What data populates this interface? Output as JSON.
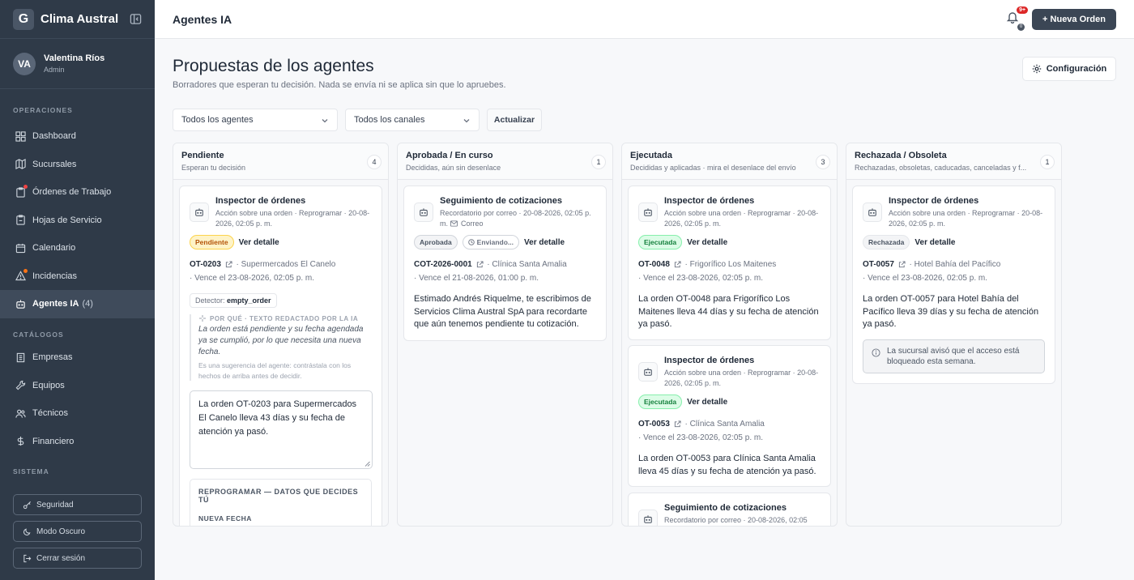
{
  "sidebar": {
    "brand_logo": "G",
    "brand_name": "Clima Austral",
    "user": {
      "initials": "VA",
      "name": "Valentina Ríos",
      "role": "Admin"
    },
    "sections": {
      "operaciones": "OPERACIONES",
      "catalogos": "CATÁLOGOS",
      "sistema": "SISTEMA"
    },
    "items": [
      {
        "label": "Dashboard",
        "icon": "dashboard-icon"
      },
      {
        "label": "Sucursales",
        "icon": "map-icon"
      },
      {
        "label": "Órdenes de Trabajo",
        "icon": "clipboard-icon",
        "dot": "#ef4444"
      },
      {
        "label": "Hojas de Servicio",
        "icon": "clipboard-icon"
      },
      {
        "label": "Calendario",
        "icon": "calendar-icon"
      },
      {
        "label": "Incidencias",
        "icon": "warning-icon",
        "dot": "#f97316"
      },
      {
        "label": "Agentes IA",
        "icon": "bot-icon",
        "count": "(4)"
      },
      {
        "label": "Empresas",
        "icon": "building-icon"
      },
      {
        "label": "Equipos",
        "icon": "wrench-icon"
      },
      {
        "label": "Técnicos",
        "icon": "users-icon"
      },
      {
        "label": "Financiero",
        "icon": "dollar-icon"
      }
    ],
    "buttons": {
      "security": "Seguridad",
      "dark_mode": "Modo Oscuro",
      "logout": "Cerrar sesión"
    }
  },
  "header": {
    "title": "Agentes IA",
    "notif_badge": "9+",
    "notif_sub": "0",
    "new_order": "+ Nueva Orden"
  },
  "main": {
    "title": "Propuestas de los agentes",
    "subtitle": "Borradores que esperan tu decisión. Nada se envía ni se aplica sin que lo apruebes.",
    "config_button": "Configuración",
    "filters": {
      "agents": "Todos los agentes",
      "channels": "Todos los canales",
      "refresh": "Actualizar"
    }
  },
  "columns": [
    {
      "title": "Pendiente",
      "subtitle": "Esperan tu decisión",
      "count": "4",
      "cards": [
        {
          "title": "Inspector de órdenes",
          "meta": "Acción sobre una orden · Reprogramar · 20-08-2026, 02:05 p. m.",
          "status": "Pendiente",
          "detail": "Ver detalle",
          "code": "OT-0203",
          "client": "· Supermercados El Canelo",
          "due": "· Vence el 23-08-2026, 02:05 p. m.",
          "detector_label": "Detector:",
          "detector_value": "empty_order",
          "why_head": "POR QUÉ · TEXTO REDACTADO POR LA IA",
          "why_text": "La orden está pendiente y su fecha agendada ya se cumplió, por lo que necesita una nueva fecha.",
          "why_note": "Es una sugerencia del agente: contrástala con los hechos de arriba antes de decidir.",
          "draft": "La orden OT-0203 para Supermercados El Canelo lleva 43 días y su fecha de atención ya pasó.",
          "resched_title": "REPROGRAMAR — DATOS QUE DECIDES TÚ",
          "resched_label": "NUEVA FECHA"
        }
      ]
    },
    {
      "title": "Aprobada / En curso",
      "subtitle": "Decididas, aún sin desenlace",
      "count": "1",
      "cards": [
        {
          "title": "Seguimiento de cotizaciones",
          "meta": "Recordatorio por correo · 20-08-2026, 02:05 p. m.",
          "channel": "Correo",
          "status": "Aprobada",
          "status2": "Enviando...",
          "detail": "Ver detalle",
          "code": "COT-2026-0001",
          "client": "· Clínica Santa Amalia",
          "due": "· Vence el 21-08-2026, 01:00 p. m.",
          "body": "Estimado Andrés Riquelme, te escribimos de Servicios Clima Austral SpA para recordarte que aún tenemos pendiente tu cotización. Si..."
        }
      ]
    },
    {
      "title": "Ejecutada",
      "subtitle": "Decididas y aplicadas · mira el desenlace del envío",
      "count": "3",
      "cards": [
        {
          "title": "Inspector de órdenes",
          "meta": "Acción sobre una orden · Reprogramar · 20-08-2026, 02:05 p. m.",
          "status": "Ejecutada",
          "detail": "Ver detalle",
          "code": "OT-0048",
          "client": "· Frigorífico Los Maitenes",
          "due": "· Vence el 23-08-2026, 02:05 p. m.",
          "body": "La orden OT-0048 para Frigorífico Los Maitenes lleva 44 días y su fecha de atención ya pasó."
        },
        {
          "title": "Inspector de órdenes",
          "meta": "Acción sobre una orden · Reprogramar · 20-08-2026, 02:05 p. m.",
          "status": "Ejecutada",
          "detail": "Ver detalle",
          "code": "OT-0053",
          "client": "· Clínica Santa Amalia",
          "due": "· Vence el 23-08-2026, 02:05 p. m.",
          "body": "La orden OT-0053 para Clínica Santa Amalia lleva 45 días y su fecha de atención ya pasó."
        },
        {
          "title": "Seguimiento de cotizaciones",
          "meta": "Recordatorio por correo · 20-08-2026, 02:05"
        }
      ]
    },
    {
      "title": "Rechazada / Obsoleta",
      "subtitle": "Rechazadas, obsoletas, caducadas, canceladas y f...",
      "count": "1",
      "cards": [
        {
          "title": "Inspector de órdenes",
          "meta": "Acción sobre una orden · Reprogramar · 20-08-2026, 02:05 p. m.",
          "status": "Rechazada",
          "detail": "Ver detalle",
          "code": "OT-0057",
          "client": "· Hotel Bahía del Pacífico",
          "due": "· Vence el 23-08-2026, 02:05 p. m.",
          "body": "La orden OT-0057 para Hotel Bahía del Pacífico lleva 39 días y su fecha de atención ya pasó.",
          "notice": "La sucursal avisó que el acceso está bloqueado esta semana."
        }
      ]
    }
  ]
}
